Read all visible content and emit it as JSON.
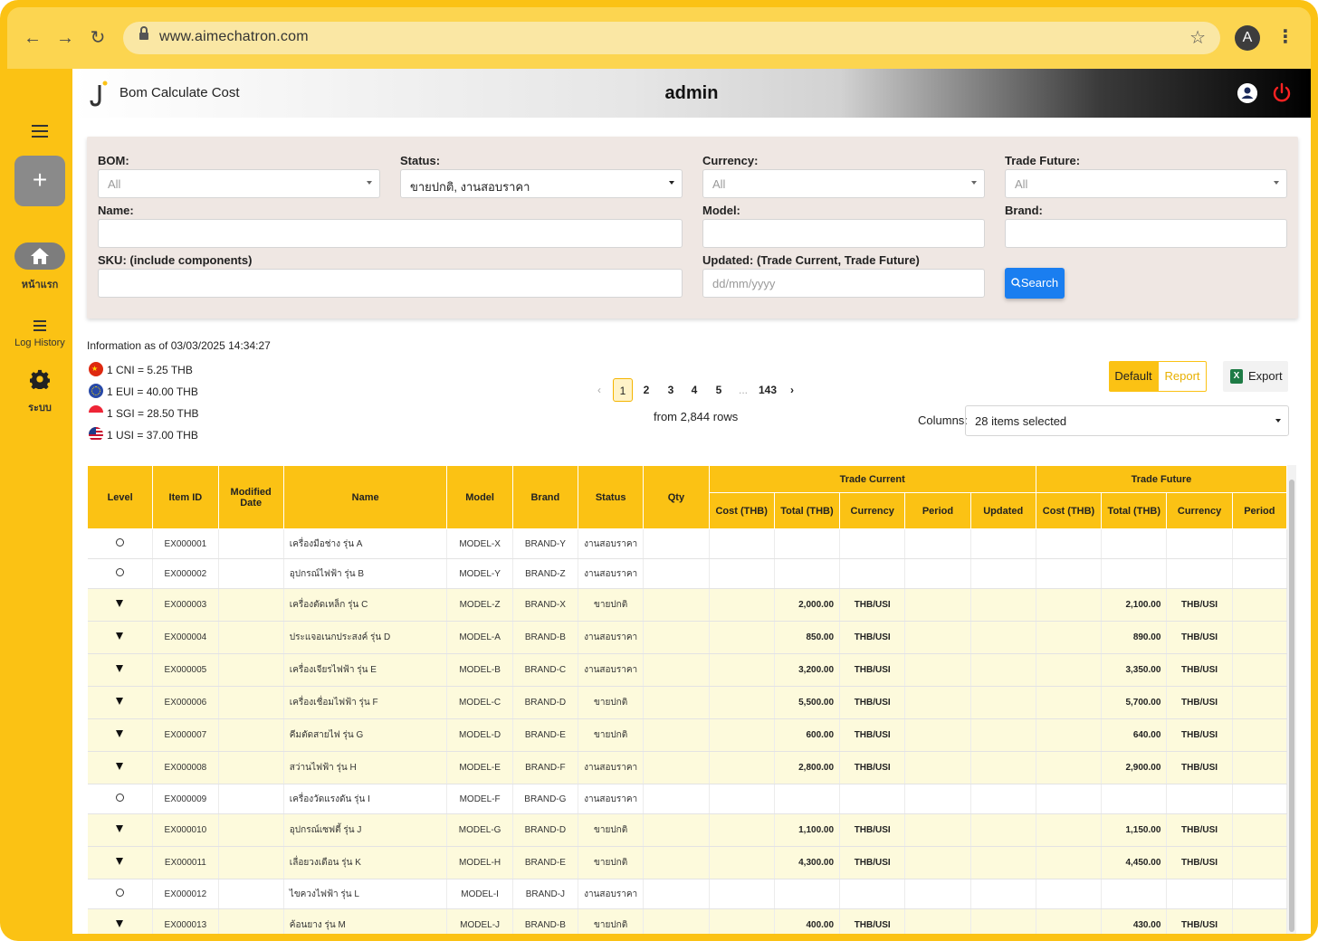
{
  "browser": {
    "url": "www.aimechatron.com",
    "profile_initial": "A"
  },
  "sidebar": {
    "items": [
      {
        "label": "หน้าแรก",
        "icon": "home-icon"
      },
      {
        "label": "Log History",
        "icon": "list-icon"
      },
      {
        "label": "ระบบ",
        "icon": "gear-icon"
      }
    ]
  },
  "header": {
    "app_title": "Bom Calculate Cost",
    "user": "admin"
  },
  "filters": {
    "bom": {
      "label": "BOM:",
      "value": "All"
    },
    "status": {
      "label": "Status:",
      "value": "ขายปกติ, งานสอบราคา"
    },
    "currency": {
      "label": "Currency:",
      "value": "All"
    },
    "trade_future": {
      "label": "Trade Future:",
      "value": "All"
    },
    "name": {
      "label": "Name:",
      "value": ""
    },
    "model": {
      "label": "Model:",
      "value": ""
    },
    "brand": {
      "label": "Brand:",
      "value": ""
    },
    "sku": {
      "label": "SKU: (include components)",
      "value": ""
    },
    "updated": {
      "label": "Updated: (Trade Current, Trade Future)",
      "placeholder": "dd/mm/yyyy"
    },
    "search_label": "Search"
  },
  "info": {
    "as_of": "Information as of 03/03/2025 14:34:27",
    "rates": [
      {
        "flag": "cn",
        "text": "1 CNI = 5.25 THB"
      },
      {
        "flag": "eu",
        "text": "1 EUI = 40.00 THB"
      },
      {
        "flag": "sg",
        "text": "1 SGI = 28.50 THB"
      },
      {
        "flag": "us",
        "text": "1 USI = 37.00 THB"
      }
    ]
  },
  "pagination": {
    "prev": "‹",
    "pages": [
      "1",
      "2",
      "3",
      "4",
      "5"
    ],
    "ellipsis": "...",
    "last": "143",
    "next": "›",
    "active": "1",
    "rows_text": "from 2,844 rows"
  },
  "toolbar": {
    "default_label": "Default",
    "report_label": "Report",
    "export_label": "Export",
    "columns_label": "Columns:",
    "columns_value": "28 items selected"
  },
  "table": {
    "headers": {
      "level": "Level",
      "item_id": "Item ID",
      "modified": "Modified Date",
      "name": "Name",
      "model": "Model",
      "brand": "Brand",
      "status": "Status",
      "qty": "Qty",
      "trade_current": "Trade Current",
      "trade_future": "Trade Future",
      "cost": "Cost (THB)",
      "total": "Total (THB)",
      "currency": "Currency",
      "period": "Period",
      "updated": "Updated"
    },
    "rows": [
      {
        "level": "circle",
        "id": "EX000001",
        "name": "เครื่องมือช่าง รุ่น A",
        "model": "MODEL-X",
        "brand": "BRAND-Y",
        "status": "งานสอบราคา",
        "tc_total": "",
        "tc_currency": "",
        "tf_total": "",
        "tf_currency": ""
      },
      {
        "level": "circle",
        "id": "EX000002",
        "name": "อุปกรณ์ไฟฟ้า รุ่น B",
        "model": "MODEL-Y",
        "brand": "BRAND-Z",
        "status": "งานสอบราคา",
        "tc_total": "",
        "tc_currency": "",
        "tf_total": "",
        "tf_currency": ""
      },
      {
        "level": "tri",
        "id": "EX000003",
        "name": "เครื่องตัดเหล็ก รุ่น C",
        "model": "MODEL-Z",
        "brand": "BRAND-X",
        "status": "ขายปกติ",
        "tc_total": "2,000.00",
        "tc_currency": "THB/USI",
        "tf_total": "2,100.00",
        "tf_currency": "THB/USI"
      },
      {
        "level": "tri",
        "id": "EX000004",
        "name": "ประแจอเนกประสงค์ รุ่น D",
        "model": "MODEL-A",
        "brand": "BRAND-B",
        "status": "งานสอบราคา",
        "tc_total": "850.00",
        "tc_currency": "THB/USI",
        "tf_total": "890.00",
        "tf_currency": "THB/USI"
      },
      {
        "level": "tri",
        "id": "EX000005",
        "name": "เครื่องเจียรไฟฟ้า รุ่น E",
        "model": "MODEL-B",
        "brand": "BRAND-C",
        "status": "งานสอบราคา",
        "tc_total": "3,200.00",
        "tc_currency": "THB/USI",
        "tf_total": "3,350.00",
        "tf_currency": "THB/USI"
      },
      {
        "level": "tri",
        "id": "EX000006",
        "name": "เครื่องเชื่อมไฟฟ้า รุ่น F",
        "model": "MODEL-C",
        "brand": "BRAND-D",
        "status": "ขายปกติ",
        "tc_total": "5,500.00",
        "tc_currency": "THB/USI",
        "tf_total": "5,700.00",
        "tf_currency": "THB/USI"
      },
      {
        "level": "tri",
        "id": "EX000007",
        "name": "คีมตัดสายไฟ รุ่น G",
        "model": "MODEL-D",
        "brand": "BRAND-E",
        "status": "ขายปกติ",
        "tc_total": "600.00",
        "tc_currency": "THB/USI",
        "tf_total": "640.00",
        "tf_currency": "THB/USI"
      },
      {
        "level": "tri",
        "id": "EX000008",
        "name": "สว่านไฟฟ้า รุ่น H",
        "model": "MODEL-E",
        "brand": "BRAND-F",
        "status": "งานสอบราคา",
        "tc_total": "2,800.00",
        "tc_currency": "THB/USI",
        "tf_total": "2,900.00",
        "tf_currency": "THB/USI"
      },
      {
        "level": "circle",
        "id": "EX000009",
        "name": "เครื่องวัดแรงดัน รุ่น I",
        "model": "MODEL-F",
        "brand": "BRAND-G",
        "status": "งานสอบราคา",
        "tc_total": "",
        "tc_currency": "",
        "tf_total": "",
        "tf_currency": ""
      },
      {
        "level": "tri",
        "id": "EX000010",
        "name": "อุปกรณ์เซฟตี้ รุ่น J",
        "model": "MODEL-G",
        "brand": "BRAND-D",
        "status": "ขายปกติ",
        "tc_total": "1,100.00",
        "tc_currency": "THB/USI",
        "tf_total": "1,150.00",
        "tf_currency": "THB/USI"
      },
      {
        "level": "tri",
        "id": "EX000011",
        "name": "เลื่อยวงเดือน รุ่น K",
        "model": "MODEL-H",
        "brand": "BRAND-E",
        "status": "ขายปกติ",
        "tc_total": "4,300.00",
        "tc_currency": "THB/USI",
        "tf_total": "4,450.00",
        "tf_currency": "THB/USI"
      },
      {
        "level": "circle",
        "id": "EX000012",
        "name": "ไขควงไฟฟ้า รุ่น L",
        "model": "MODEL-I",
        "brand": "BRAND-J",
        "status": "งานสอบราคา",
        "tc_total": "",
        "tc_currency": "",
        "tf_total": "",
        "tf_currency": ""
      },
      {
        "level": "tri",
        "id": "EX000013",
        "name": "ค้อนยาง รุ่น M",
        "model": "MODEL-J",
        "brand": "BRAND-B",
        "status": "ขายปกติ",
        "tc_total": "400.00",
        "tc_currency": "THB/USI",
        "tf_total": "430.00",
        "tf_currency": "THB/USI"
      }
    ]
  }
}
